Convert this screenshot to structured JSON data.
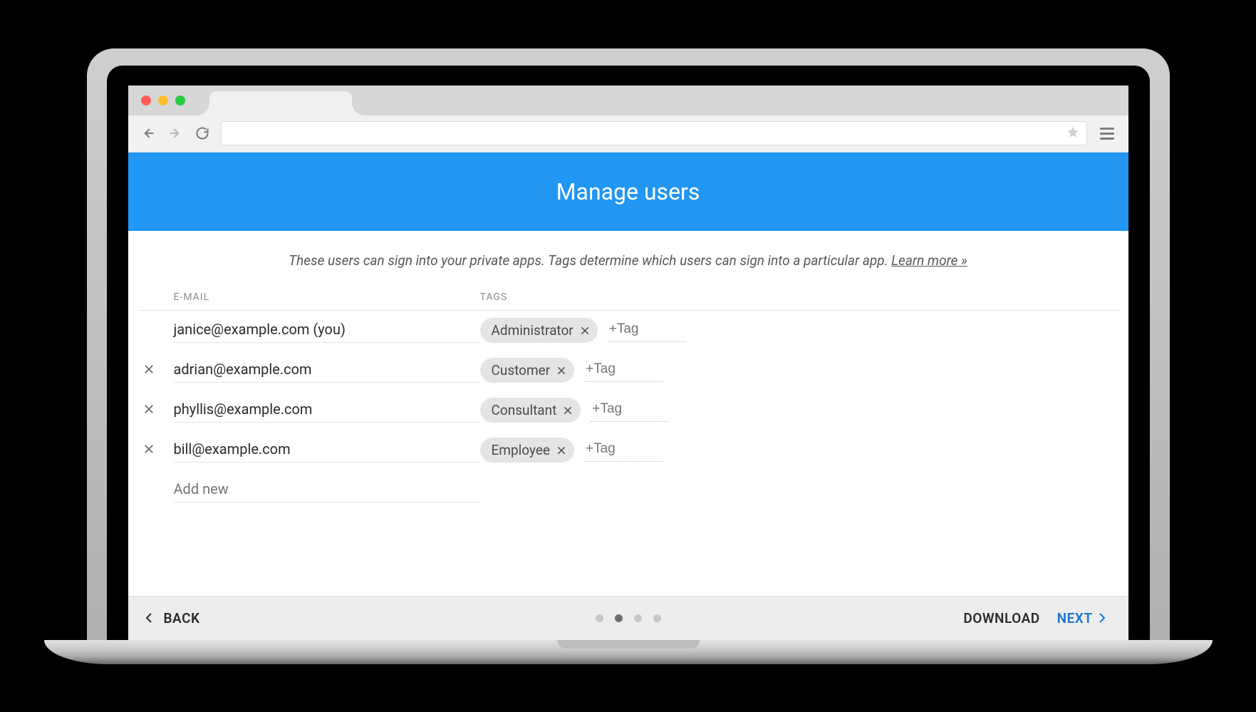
{
  "colors": {
    "header_bg": "#2196f3",
    "primary": "#1976d2"
  },
  "page": {
    "title": "Manage users",
    "description_text": "These users can sign into your private apps. Tags determine which users can sign into a particular app. ",
    "learn_more_label": "Learn more »"
  },
  "table": {
    "headers": {
      "email": "E-MAIL",
      "tags": "TAGS"
    },
    "rows": [
      {
        "removable": false,
        "email": "janice@example.com (you)",
        "tags": [
          "Administrator"
        ]
      },
      {
        "removable": true,
        "email": "adrian@example.com",
        "tags": [
          "Customer"
        ]
      },
      {
        "removable": true,
        "email": "phyllis@example.com",
        "tags": [
          "Consultant"
        ]
      },
      {
        "removable": true,
        "email": "bill@example.com",
        "tags": [
          "Employee"
        ]
      }
    ],
    "add_new_placeholder": "Add new",
    "tag_input_placeholder": "+Tag"
  },
  "footer": {
    "back_label": "BACK",
    "download_label": "DOWNLOAD",
    "next_label": "NEXT",
    "steps_total": 4,
    "steps_active_index": 1
  }
}
